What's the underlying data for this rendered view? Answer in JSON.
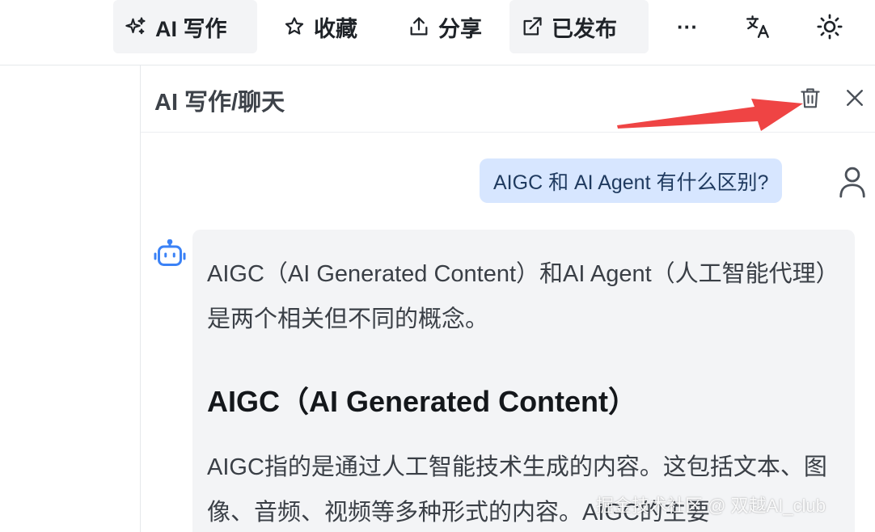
{
  "toolbar": {
    "ai_write_label": "AI 写作",
    "favorite_label": "收藏",
    "share_label": "分享",
    "published_label": "已发布",
    "more_label": "···"
  },
  "panel": {
    "title": "AI 写作/聊天"
  },
  "chat": {
    "user_message": "AIGC 和 AI Agent 有什么区别?",
    "bot_paragraph_1": "AIGC（AI Generated Content）和AI Agent（人工智能代理）是两个相关但不同的概念。",
    "bot_heading": "AIGC（AI Generated Content）",
    "bot_paragraph_2": "AIGC指的是通过人工智能技术生成的内容。这包括文本、图像、音频、视频等多种形式的内容。AIGC的主要"
  },
  "watermark": "掘金技术社区 @ 双越AI_club",
  "icons": {
    "ai_write": "sparkles-icon",
    "favorite": "star-icon",
    "share": "share-upload-icon",
    "published": "external-link-icon",
    "translate": "translate-icon",
    "theme": "sun-icon",
    "clear": "trash-icon",
    "close": "close-icon",
    "user": "user-icon",
    "bot": "robot-icon"
  },
  "colors": {
    "user_bubble": "#d7e6ff",
    "bot_bubble": "#f3f4f6",
    "bot_icon": "#3b82f6",
    "annotation_arrow": "#ef4444"
  }
}
